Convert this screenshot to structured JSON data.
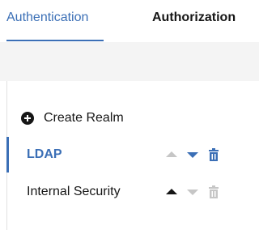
{
  "tabs": {
    "authentication": "Authentication",
    "authorization": "Authorization"
  },
  "actions": {
    "create_realm": "Create Realm"
  },
  "realms": [
    {
      "name": "LDAP",
      "selected": true,
      "move_up_enabled": false,
      "move_down_enabled": true,
      "delete_enabled": true
    },
    {
      "name": "Internal Security",
      "selected": false,
      "move_up_enabled": true,
      "move_down_enabled": false,
      "delete_enabled": false
    }
  ],
  "colors": {
    "accent": "#3b6fb6",
    "text": "#161616",
    "disabled": "#c6c6c6",
    "band": "#f4f4f4"
  },
  "icons": {
    "create": "add-filled-icon",
    "up": "caret-up-icon",
    "down": "caret-down-icon",
    "delete": "trash-can-icon"
  }
}
